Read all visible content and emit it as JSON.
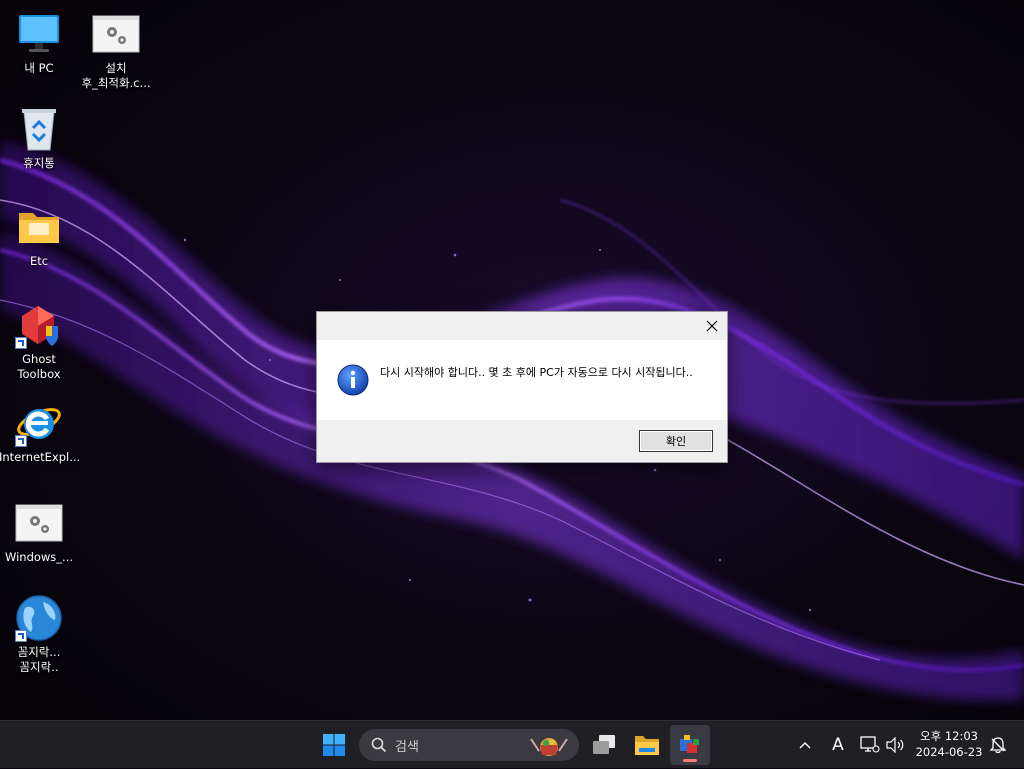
{
  "desktop": {
    "icons": [
      {
        "label": "내 PC",
        "icon": "this-pc-icon"
      },
      {
        "label": "설치\n후_최적화.c...",
        "icon": "settings-file-icon"
      },
      {
        "label": "휴지통",
        "icon": "recycle-bin-icon"
      },
      {
        "label": "Etc",
        "icon": "folder-icon"
      },
      {
        "label": "Ghost\nToolbox",
        "icon": "ghost-toolbox-icon"
      },
      {
        "label": "InternetExpl...",
        "icon": "internet-explorer-icon"
      },
      {
        "label": "Windows_...",
        "icon": "settings-file-icon"
      },
      {
        "label": "꼼지락...\n꼼지락..",
        "icon": "globe-icon"
      }
    ]
  },
  "dialog": {
    "message": "다시 시작해야 합니다.. 몇 초 후에 PC가 자동으로 다시 시작됩니다..",
    "ok_label": "확인",
    "close_icon": "close-icon",
    "info_icon": "info-icon"
  },
  "taskbar": {
    "search_placeholder": "검색",
    "clock_time": "오후 12:03",
    "clock_date": "2024-06-23",
    "ime_label": "A",
    "accent": "#ff7a7a"
  }
}
